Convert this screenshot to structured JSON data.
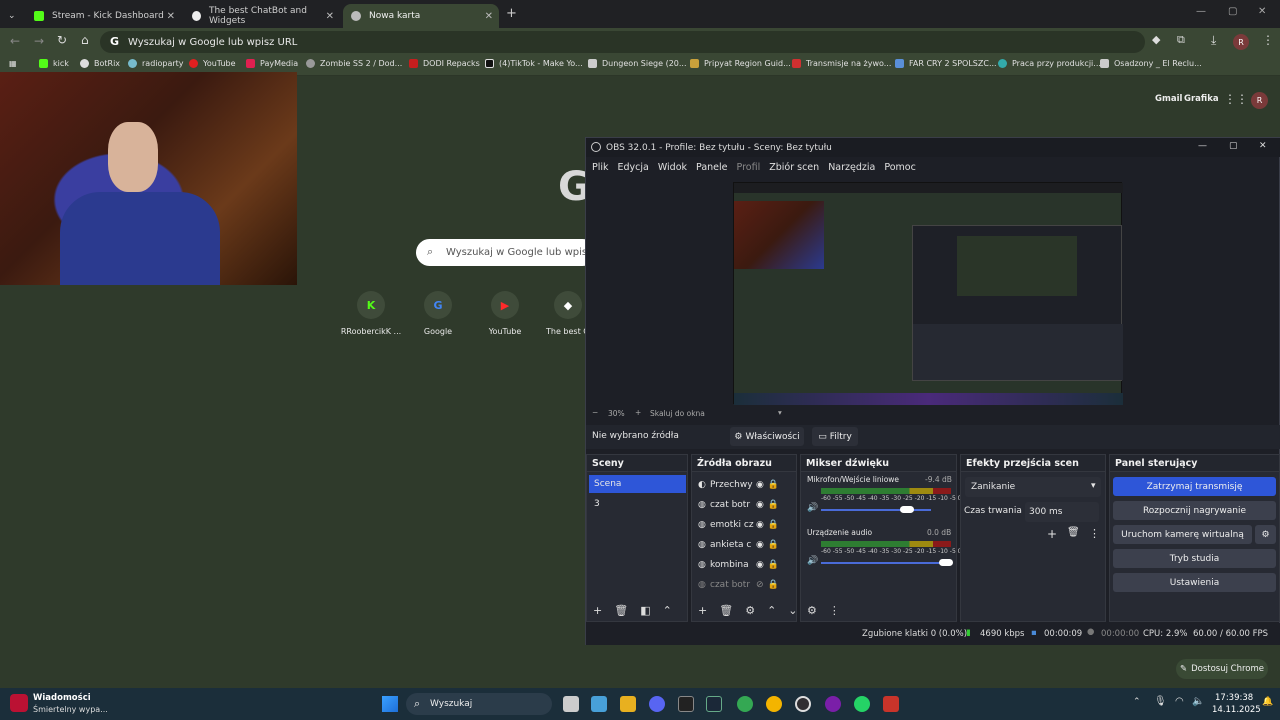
{
  "browser": {
    "tabs": [
      {
        "title": "Stream - Kick Dashboard",
        "active": false
      },
      {
        "title": "The best ChatBot and Widgets",
        "active": false
      },
      {
        "title": "Nowa karta",
        "active": true
      }
    ],
    "omnibox_text": "Wyszukaj w Google lub wpisz URL",
    "bookmarks": [
      "kick",
      "BotRix",
      "radioparty",
      "YouTube",
      "PayMedia",
      "Zombie SS 2 / Dod...",
      "DODI Repacks",
      "(4)TikTok - Make Yo...",
      "Dungeon Siege (20...",
      "Pripyat Region Guid...",
      "Transmisje na żywo...",
      "FAR CRY 2 SPOLSZC...",
      "Praca przy produkcji...",
      "Osadzony _ El Reclu..."
    ],
    "profile_initial": "R"
  },
  "ntp": {
    "search_placeholder": "Wyszukaj w Google lub wpisz URL",
    "links": [
      "Gmail",
      "Grafika"
    ],
    "shortcuts": [
      {
        "label": "RRoobercikK ...",
        "icon": "kick-icon"
      },
      {
        "label": "Google",
        "icon": "google-icon"
      },
      {
        "label": "YouTube",
        "icon": "youtube-icon"
      },
      {
        "label": "The best Ch",
        "icon": "botrix-icon"
      }
    ],
    "customize_label": "Dostosuj Chrome"
  },
  "obs": {
    "title": "OBS 32.0.1 - Profile: Bez tytułu - Sceny: Bez tytułu",
    "menu": [
      "Plik",
      "Edycja",
      "Widok",
      "Panele",
      "Profil",
      "Zbiór scen",
      "Narzędzia",
      "Pomoc"
    ],
    "zoom": "30%",
    "zoom_fit": "Skaluj do okna",
    "no_source": "Nie wybrano źródła",
    "properties_label": "Właściwości",
    "filters_label": "Filtry",
    "scenes": {
      "title": "Sceny",
      "items": [
        "Scena",
        "3"
      ]
    },
    "sources": {
      "title": "Źródła obrazu",
      "items": [
        "Przechwy",
        "czat botr",
        "emotki cz",
        "ankieta c",
        "kombina",
        "czat botr"
      ]
    },
    "mixer": {
      "title": "Mikser dźwięku",
      "channels": [
        {
          "name": "Mikrofon/Wejście liniowe",
          "db": "-9.4 dB",
          "level": 0.6
        },
        {
          "name": "Urządzenie audio",
          "db": "0.0 dB",
          "level": 0.95
        }
      ],
      "scale": "-60 -55 -50 -45 -40 -35 -30 -25 -20 -15 -10 -5 0"
    },
    "transitions": {
      "title": "Efekty przejścia scen",
      "selected": "Zanikanie",
      "duration_label": "Czas trwania",
      "duration": "300 ms"
    },
    "controls": {
      "title": "Panel sterujący",
      "buttons": [
        "Zatrzymaj transmisję",
        "Rozpocznij nagrywanie",
        "Uruchom kamerę wirtualną",
        "Tryb studia",
        "Ustawienia"
      ]
    },
    "status": {
      "dropped": "Zgubione klatki 0 (0.0%)",
      "bitrate": "4690 kbps",
      "stream_time": "00:00:09",
      "rec_time": "00:00:00",
      "cpu": "CPU: 2.9%",
      "fps": "60.00 / 60.00 FPS"
    }
  },
  "taskbar": {
    "notification_title": "Wiadomości",
    "notification_text": "Śmiertelny wypa...",
    "search_label": "Wyszukaj",
    "time": "17:39:38",
    "date": "14.11.2025"
  }
}
